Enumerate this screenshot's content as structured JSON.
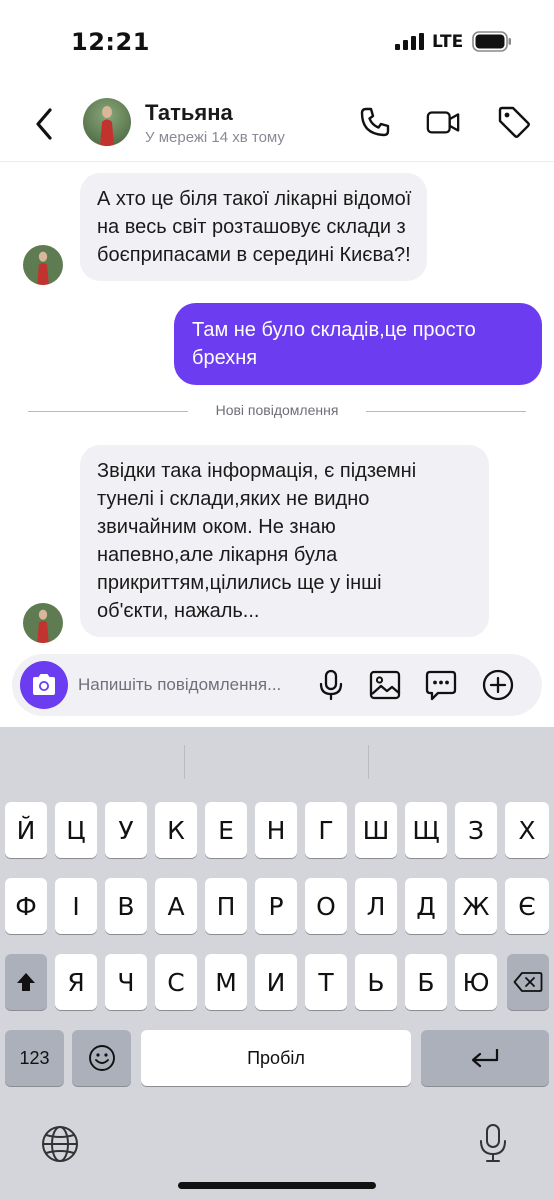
{
  "status_bar": {
    "time": "12:21",
    "network": "LTE"
  },
  "header": {
    "contact_name": "Татьяна",
    "contact_status": "У мережі 14 хв тому",
    "icons": [
      "back-chevron-icon",
      "phone-icon",
      "video-icon",
      "tag-icon"
    ]
  },
  "messages": [
    {
      "direction": "incoming",
      "lines": [
        "А хто це біля такої лікарні відомої",
        "на весь світ розташовує склади з",
        "боєприпасами в середині Києва?!"
      ]
    },
    {
      "direction": "outgoing",
      "lines": [
        "Там не було складів,це просто",
        "брехня"
      ]
    },
    {
      "direction": "incoming",
      "lines": [
        "Звідки така інформація, є підземні",
        "тунелі і склади,яких не видно",
        "звичайним оком. Не знаю",
        "напевно,але лікарня була",
        "прикриттям,цілились ще у інші",
        "об'єкти, нажаль..."
      ]
    }
  ],
  "divider": {
    "label": "Нові повідомлення"
  },
  "composer": {
    "placeholder": "Напишіть повідомлення...",
    "icons": [
      "camera-icon",
      "microphone-icon",
      "image-icon",
      "chat-dots-icon",
      "plus-circle-icon"
    ]
  },
  "keyboard": {
    "row1": [
      "Й",
      "Ц",
      "У",
      "К",
      "Е",
      "Н",
      "Г",
      "Ш",
      "Щ",
      "З",
      "Х"
    ],
    "row2": [
      "Ф",
      "І",
      "В",
      "А",
      "П",
      "Р",
      "О",
      "Л",
      "Д",
      "Ж",
      "Є"
    ],
    "row3": [
      "Я",
      "Ч",
      "С",
      "М",
      "И",
      "Т",
      "Ь",
      "Б",
      "Ю"
    ],
    "numbers_key": "123",
    "space_key": "Пробіл",
    "icons": [
      "shift-icon",
      "backspace-icon",
      "emoji-icon",
      "return-icon",
      "globe-icon",
      "dictation-mic-icon"
    ]
  },
  "colors": {
    "accent": "#6c3cf0",
    "incoming_bubble": "#f1f1f5",
    "keyboard_bg": "#d3d5db"
  }
}
